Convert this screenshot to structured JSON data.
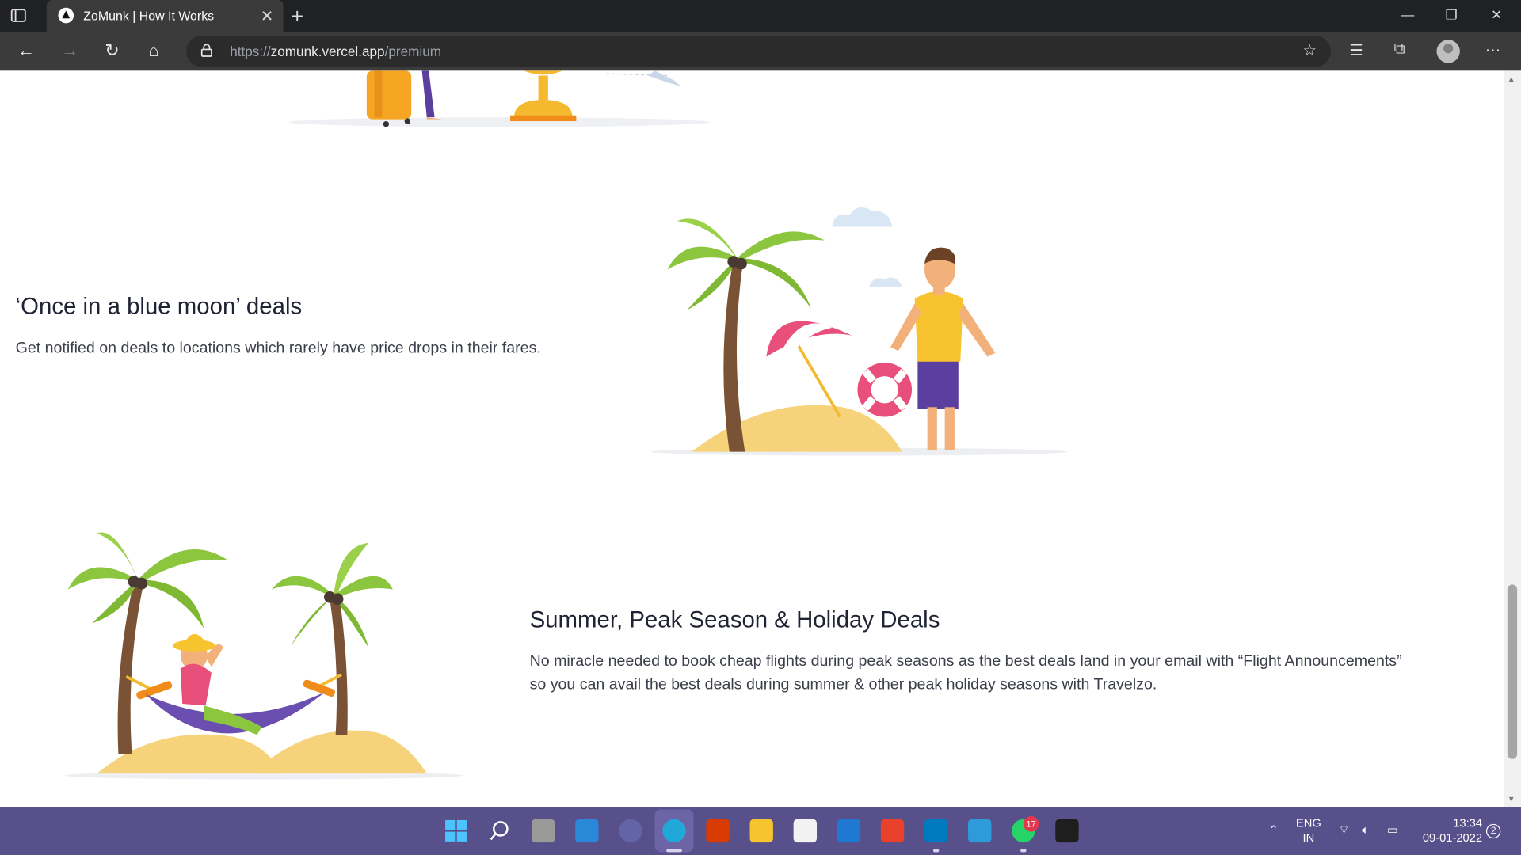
{
  "browser": {
    "tab_title": "ZoMunk | How It Works",
    "url_scheme": "https://",
    "url_host": "zomunk.vercel.app",
    "url_path": "/premium"
  },
  "sections": {
    "blue_moon": {
      "heading": "‘Once in a blue moon’ deals",
      "body": "Get notified on deals to locations which rarely have price drops in their fares."
    },
    "summer": {
      "heading": "Summer, Peak Season & Holiday Deals",
      "body_line1": "No miracle needed to book cheap flights during peak seasons as the best deals land in your email with “Flight Announcements”",
      "body_line2": "so you can avail the best deals during summer & other peak holiday seasons with Travelzo."
    }
  },
  "taskbar": {
    "lang_line1": "ENG",
    "lang_line2": "IN",
    "time": "13:34",
    "date": "09-01-2022",
    "whatsapp_badge": "17",
    "notification_count": "2"
  },
  "colors": {
    "heading": "#1f2333",
    "body": "#3b3f4a",
    "taskbar": "#58508a",
    "palm_leaf": "#8cc63f",
    "sand": "#f6d27a"
  }
}
